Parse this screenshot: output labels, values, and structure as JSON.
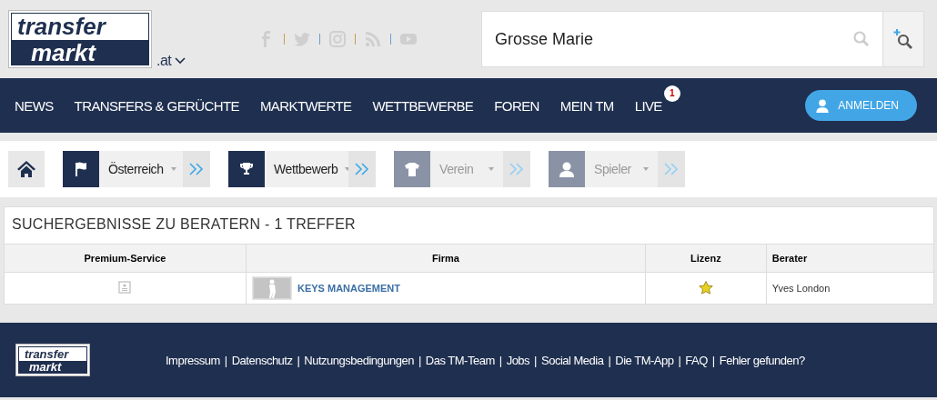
{
  "logo": {
    "line_1": "transfer",
    "line_2": "markt",
    "domain": ".at"
  },
  "social": [
    {
      "kind": "facebook"
    },
    {
      "kind": "twitter"
    },
    {
      "kind": "instagram"
    },
    {
      "kind": "rss"
    },
    {
      "kind": "youtube"
    }
  ],
  "search": {
    "value": "Grosse Marie"
  },
  "nav": [
    {
      "label": "NEWS"
    },
    {
      "label": "TRANSFERS & GERÜCHTE"
    },
    {
      "label": "MARKTWERTE"
    },
    {
      "label": "WETTBEWERBE"
    },
    {
      "label": "FOREN"
    },
    {
      "label": "MEIN TM"
    },
    {
      "label": "LIVE",
      "badge": "1"
    }
  ],
  "login_button": "ANMELDEN",
  "breadcrumbs": [
    {
      "kind": "country",
      "label": "Österreich",
      "disabled": false
    },
    {
      "kind": "competition",
      "label": "Wettbewerb",
      "disabled": false
    },
    {
      "kind": "club",
      "label": "Verein",
      "disabled": true
    },
    {
      "kind": "player",
      "label": "Spieler",
      "disabled": true
    }
  ],
  "results": {
    "title": "SUCHERGEBNISSE ZU BERATERN - 1 TREFFER",
    "columns": [
      "Premium-Service",
      "Firma",
      "Lizenz",
      "Berater"
    ],
    "rows": [
      {
        "firm": "KEYS MANAGEMENT",
        "licensed": true,
        "agent": "Yves London"
      }
    ]
  },
  "footer": {
    "logo": {
      "line_1": "transfer",
      "line_2": "markt"
    },
    "separator": "|",
    "links": [
      "Impressum",
      "Datenschutz",
      "Nutzungsbedingungen",
      "Das TM-Team",
      "Jobs",
      "Social Media",
      "Die TM-App",
      "FAQ",
      "Fehler gefunden?"
    ]
  }
}
